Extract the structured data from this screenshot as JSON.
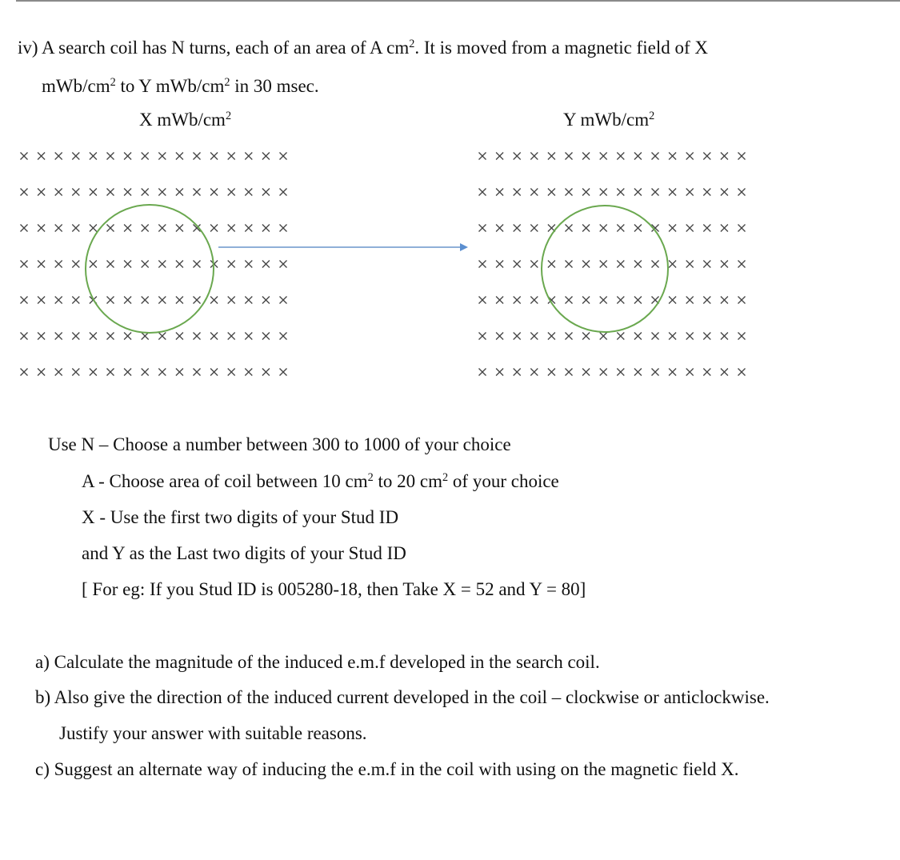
{
  "question": {
    "intro_line1": {
      "before": "iv) A search coil has N turns, each of an area of A cm",
      "sup": "2",
      "after": ". It is moved from a magnetic field of X"
    },
    "intro_line2": {
      "a": "mWb/cm",
      "sup1": "2",
      "b": " to Y mWb/cm",
      "sup2": "2",
      "c": " in 30 msec."
    }
  },
  "diagram": {
    "left_label": {
      "text": "X mWb/cm",
      "sup": "2"
    },
    "right_label": {
      "text": "Y mWb/cm",
      "sup": "2"
    },
    "field_symbol": "×",
    "field_direction": "into page",
    "grid_rows": 7,
    "grid_cols": 16,
    "coil_color": "#6aa84f",
    "arrow_color": "#5b8fd0",
    "cross_color": "#444444"
  },
  "instructions": {
    "n_line": "Use N – Choose a number between 300 to 1000 of your choice",
    "a_line": {
      "before": "A -  Choose area of coil between 10 cm",
      "sup1": "2",
      "mid": " to 20 cm",
      "sup2": "2",
      "after": " of your choice"
    },
    "x_line": "X -  Use the first two digits of your Stud ID",
    "y_line": "and Y as the Last two digits of your Stud ID",
    "example_line": "[ For eg:  If you Stud ID is 005280-18, then Take X = 52 and Y = 80]"
  },
  "parts": {
    "a": "a)  Calculate the magnitude of the induced e.m.f developed in the search coil.",
    "b1": "b)  Also give the direction of the induced current developed in the coil – clockwise or anticlockwise.",
    "b2": "Justify your answer with suitable reasons.",
    "c": "c) Suggest an alternate way of inducing the e.m.f in the coil with using on the magnetic field X."
  }
}
